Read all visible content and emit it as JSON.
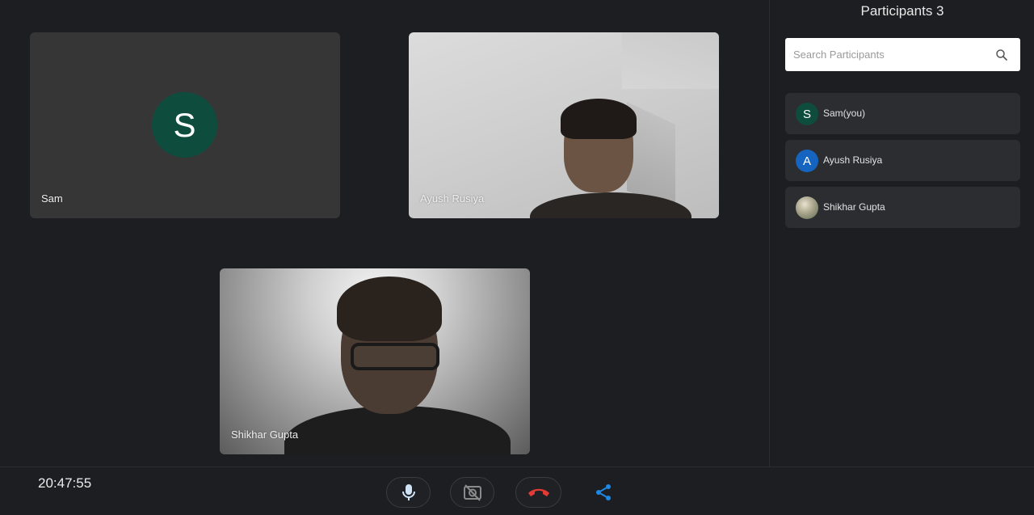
{
  "tiles": [
    {
      "name": "Sam",
      "avatar_letter": "S",
      "avatar_color": "#0e4d3e",
      "video": false
    },
    {
      "name": "Ayush Rusiya",
      "video": true
    },
    {
      "name": "Shikhar Gupta",
      "video": true
    }
  ],
  "sidebar": {
    "title": "Participants 3",
    "search_placeholder": "Search Participants",
    "participants": [
      {
        "name": "Sam(you)",
        "letter": "S",
        "color": "#0e4d3e"
      },
      {
        "name": "Ayush Rusiya",
        "letter": "A",
        "color": "#1565c0"
      },
      {
        "name": "Shikhar Gupta",
        "letter": "",
        "avatar": "photo"
      }
    ]
  },
  "toolbar": {
    "clock": "20:47:55",
    "buttons": [
      "mic-icon",
      "video-off-icon",
      "hang-up-icon",
      "share-icon"
    ],
    "accent": "#1e88e5",
    "danger": "#e53935"
  }
}
